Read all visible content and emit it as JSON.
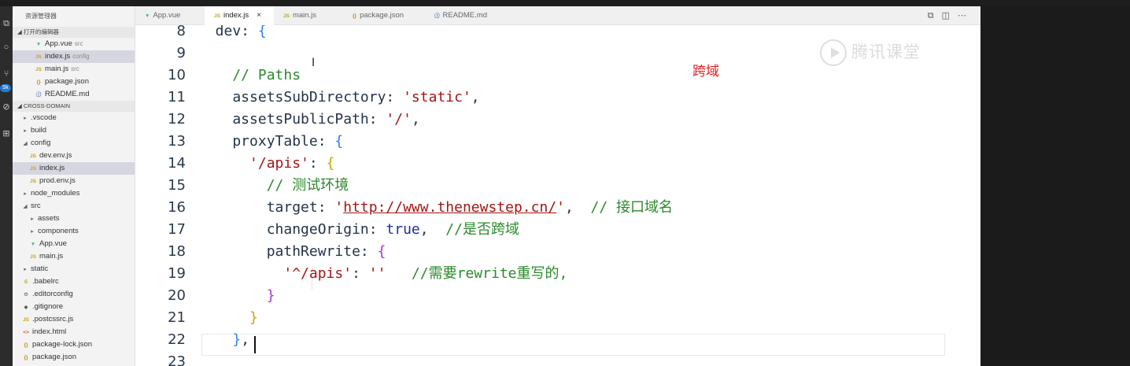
{
  "sidebar": {
    "title": "资源管理器",
    "open_editors_header": "打开的编辑器",
    "open_editors": [
      {
        "icon": "vue-icon",
        "icon_text": "▼",
        "name": "App.vue",
        "hint": "src",
        "selected": false
      },
      {
        "icon": "js-icon",
        "icon_text": "JS",
        "name": "index.js",
        "hint": "config",
        "selected": true
      },
      {
        "icon": "js-icon",
        "icon_text": "JS",
        "name": "main.js",
        "hint": "src",
        "selected": false
      },
      {
        "icon": "json-icon",
        "icon_text": "{}",
        "name": "package.json",
        "hint": "",
        "selected": false
      },
      {
        "icon": "info-icon",
        "icon_text": "ⓘ",
        "name": "README.md",
        "hint": "",
        "selected": false
      }
    ],
    "project_header": "CROSS-DOMAIN",
    "tree": [
      {
        "type": "folder",
        "expanded": false,
        "name": ".vscode",
        "depth": 0
      },
      {
        "type": "folder",
        "expanded": false,
        "name": "build",
        "depth": 0
      },
      {
        "type": "folder",
        "expanded": true,
        "name": "config",
        "depth": 0
      },
      {
        "type": "file",
        "icon": "js-icon",
        "icon_text": "JS",
        "name": "dev.env.js",
        "depth": 1
      },
      {
        "type": "file",
        "icon": "js-icon",
        "icon_text": "JS",
        "name": "index.js",
        "depth": 1,
        "selected": true
      },
      {
        "type": "file",
        "icon": "js-icon",
        "icon_text": "JS",
        "name": "prod.env.js",
        "depth": 1
      },
      {
        "type": "folder",
        "expanded": false,
        "name": "node_modules",
        "depth": 0
      },
      {
        "type": "folder",
        "expanded": true,
        "name": "src",
        "depth": 0
      },
      {
        "type": "folder",
        "expanded": false,
        "name": "assets",
        "depth": 1
      },
      {
        "type": "folder",
        "expanded": false,
        "name": "components",
        "depth": 1
      },
      {
        "type": "file",
        "icon": "vue-icon",
        "icon_text": "▼",
        "name": "App.vue",
        "depth": 1
      },
      {
        "type": "file",
        "icon": "js-icon",
        "icon_text": "JS",
        "name": "main.js",
        "depth": 1
      },
      {
        "type": "folder",
        "expanded": false,
        "name": "static",
        "depth": 0
      },
      {
        "type": "file",
        "icon": "babel-icon",
        "icon_text": "б",
        "name": ".babelrc",
        "depth": 0
      },
      {
        "type": "file",
        "icon": "gear-icon",
        "icon_text": "⚙",
        "name": ".editorconfig",
        "depth": 0
      },
      {
        "type": "file",
        "icon": "git-icon",
        "icon_text": "◆",
        "name": ".gitignore",
        "depth": 0
      },
      {
        "type": "file",
        "icon": "js-icon",
        "icon_text": "JS",
        "name": ".postcssrc.js",
        "depth": 0
      },
      {
        "type": "file",
        "icon": "html-icon",
        "icon_text": "<>",
        "name": "index.html",
        "depth": 0
      },
      {
        "type": "file",
        "icon": "json-icon",
        "icon_text": "{}",
        "name": "package-lock.json",
        "depth": 0
      },
      {
        "type": "file",
        "icon": "json-icon",
        "icon_text": "{}",
        "name": "package.json",
        "depth": 0
      }
    ]
  },
  "tabs": [
    {
      "icon": "vue-icon",
      "icon_text": "▼",
      "label": "App.vue",
      "active": false
    },
    {
      "icon": "js-icon",
      "icon_text": "JS",
      "label": "index.js",
      "active": true,
      "close": "×"
    },
    {
      "icon": "js-icon",
      "icon_text": "JS",
      "label": "main.js",
      "active": false
    },
    {
      "icon": "json-icon",
      "icon_text": "{}",
      "label": "package.json",
      "active": false
    },
    {
      "icon": "info-icon",
      "icon_text": "ⓘ",
      "label": "README.md",
      "active": false
    }
  ],
  "tab_actions": [
    "⧉",
    "◫",
    "⋯"
  ],
  "editor": {
    "lines": [
      {
        "n": "8",
        "tokens": [
          [
            "key",
            "  dev: "
          ],
          [
            "br1",
            "{"
          ]
        ]
      },
      {
        "n": "9",
        "tokens": []
      },
      {
        "n": "10",
        "tokens": [
          [
            "com",
            "    // Paths"
          ]
        ]
      },
      {
        "n": "11",
        "tokens": [
          [
            "key",
            "    assetsSubDirectory: "
          ],
          [
            "str",
            "'static'"
          ],
          [
            "pun",
            ","
          ]
        ]
      },
      {
        "n": "12",
        "tokens": [
          [
            "key",
            "    assetsPublicPath: "
          ],
          [
            "str",
            "'/'"
          ],
          [
            "pun",
            ","
          ]
        ]
      },
      {
        "n": "13",
        "tokens": [
          [
            "key",
            "    proxyTable: "
          ],
          [
            "br1",
            "{"
          ]
        ]
      },
      {
        "n": "14",
        "tokens": [
          [
            "str",
            "      '/apis'"
          ],
          [
            "pun",
            ": "
          ],
          [
            "br2",
            "{"
          ]
        ]
      },
      {
        "n": "15",
        "tokens": [
          [
            "com",
            "        // 测试环境"
          ]
        ]
      },
      {
        "n": "16",
        "tokens": [
          [
            "key",
            "        target: "
          ],
          [
            "str",
            "'"
          ],
          [
            "url",
            "http://www.thenewstep.cn/"
          ],
          [
            "str",
            "'"
          ],
          [
            "pun",
            ",  "
          ],
          [
            "com",
            "// 接口域名"
          ]
        ]
      },
      {
        "n": "17",
        "tokens": [
          [
            "key",
            "        changeOrigin: "
          ],
          [
            "lit",
            "true"
          ],
          [
            "pun",
            ",  "
          ],
          [
            "com",
            "//是否跨域"
          ]
        ]
      },
      {
        "n": "18",
        "tokens": [
          [
            "key",
            "        pathRewrite: "
          ],
          [
            "br3",
            "{"
          ]
        ]
      },
      {
        "n": "19",
        "tokens": [
          [
            "str",
            "          '^/apis'"
          ],
          [
            "pun",
            ": "
          ],
          [
            "str",
            "''"
          ],
          [
            "com",
            "   //需要rewrite重写的,"
          ]
        ]
      },
      {
        "n": "20",
        "tokens": [
          [
            "br3",
            "        }"
          ]
        ]
      },
      {
        "n": "21",
        "tokens": [
          [
            "br2",
            "      }"
          ]
        ]
      },
      {
        "n": "22",
        "tokens": [
          [
            "br1",
            "    }"
          ],
          [
            "pun",
            ","
          ]
        ]
      },
      {
        "n": "23",
        "tokens": []
      }
    ],
    "annotation": "跨域",
    "watermark": "腾讯课堂"
  }
}
